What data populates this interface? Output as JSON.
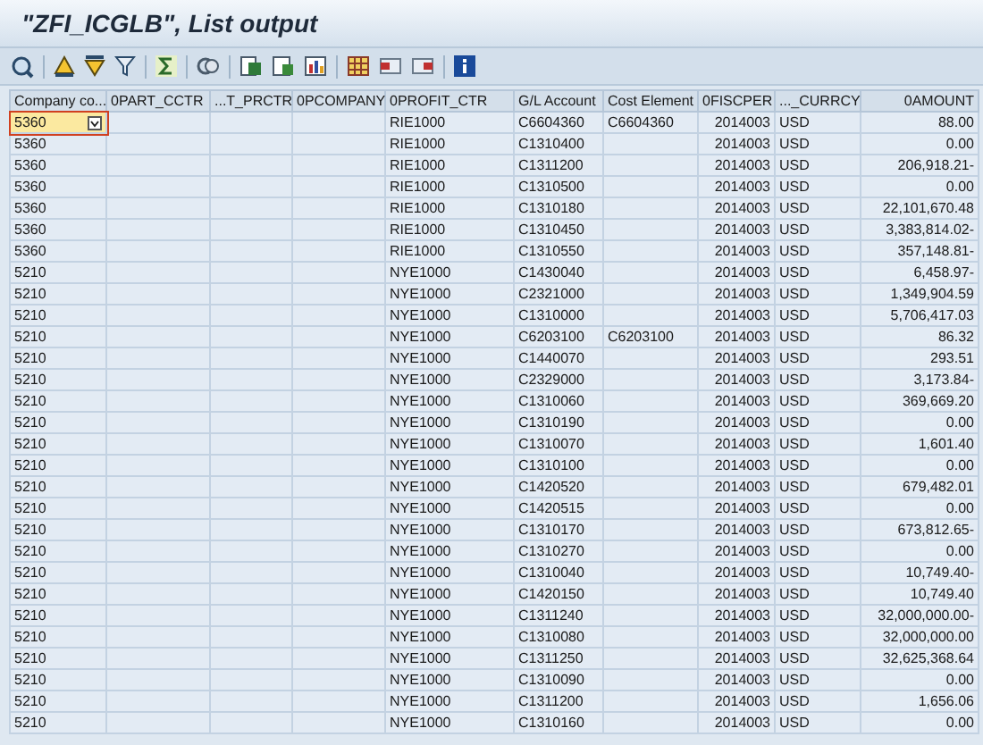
{
  "window": {
    "title": "\"ZFI_ICGLB\", List output"
  },
  "table": {
    "columns": [
      {
        "label": "Company co..."
      },
      {
        "label": "0PART_CCTR"
      },
      {
        "label": "...T_PRCTR"
      },
      {
        "label": "0PCOMPANY"
      },
      {
        "label": "0PROFIT_CTR"
      },
      {
        "label": "G/L Account"
      },
      {
        "label": "Cost Element"
      },
      {
        "label": "0FISCPER"
      },
      {
        "label": "..._CURRCY"
      },
      {
        "label": "0AMOUNT"
      }
    ],
    "rows": [
      {
        "selected": true,
        "company_code": "5360",
        "profit_ctr": "RIE1000",
        "gl_account": "C6604360",
        "cost_element": "C6604360",
        "fiscper": "2014003",
        "currency": "USD",
        "amount": "88.00"
      },
      {
        "selected": false,
        "company_code": "5360",
        "profit_ctr": "RIE1000",
        "gl_account": "C1310400",
        "fiscper": "2014003",
        "currency": "USD",
        "amount": "0.00"
      },
      {
        "selected": false,
        "company_code": "5360",
        "profit_ctr": "RIE1000",
        "gl_account": "C1311200",
        "fiscper": "2014003",
        "currency": "USD",
        "amount": "206,918.21-"
      },
      {
        "selected": false,
        "company_code": "5360",
        "profit_ctr": "RIE1000",
        "gl_account": "C1310500",
        "fiscper": "2014003",
        "currency": "USD",
        "amount": "0.00"
      },
      {
        "selected": false,
        "company_code": "5360",
        "profit_ctr": "RIE1000",
        "gl_account": "C1310180",
        "fiscper": "2014003",
        "currency": "USD",
        "amount": "22,101,670.48"
      },
      {
        "selected": false,
        "company_code": "5360",
        "profit_ctr": "RIE1000",
        "gl_account": "C1310450",
        "fiscper": "2014003",
        "currency": "USD",
        "amount": "3,383,814.02-"
      },
      {
        "selected": false,
        "company_code": "5360",
        "profit_ctr": "RIE1000",
        "gl_account": "C1310550",
        "fiscper": "2014003",
        "currency": "USD",
        "amount": "357,148.81-"
      },
      {
        "selected": false,
        "company_code": "5210",
        "profit_ctr": "NYE1000",
        "gl_account": "C1430040",
        "fiscper": "2014003",
        "currency": "USD",
        "amount": "6,458.97-"
      },
      {
        "selected": false,
        "company_code": "5210",
        "profit_ctr": "NYE1000",
        "gl_account": "C2321000",
        "fiscper": "2014003",
        "currency": "USD",
        "amount": "1,349,904.59"
      },
      {
        "selected": false,
        "company_code": "5210",
        "profit_ctr": "NYE1000",
        "gl_account": "C1310000",
        "fiscper": "2014003",
        "currency": "USD",
        "amount": "5,706,417.03"
      },
      {
        "selected": false,
        "company_code": "5210",
        "profit_ctr": "NYE1000",
        "gl_account": "C6203100",
        "cost_element": "C6203100",
        "fiscper": "2014003",
        "currency": "USD",
        "amount": "86.32"
      },
      {
        "selected": false,
        "company_code": "5210",
        "profit_ctr": "NYE1000",
        "gl_account": "C1440070",
        "fiscper": "2014003",
        "currency": "USD",
        "amount": "293.51"
      },
      {
        "selected": false,
        "company_code": "5210",
        "profit_ctr": "NYE1000",
        "gl_account": "C2329000",
        "fiscper": "2014003",
        "currency": "USD",
        "amount": "3,173.84-"
      },
      {
        "selected": false,
        "company_code": "5210",
        "profit_ctr": "NYE1000",
        "gl_account": "C1310060",
        "fiscper": "2014003",
        "currency": "USD",
        "amount": "369,669.20"
      },
      {
        "selected": false,
        "company_code": "5210",
        "profit_ctr": "NYE1000",
        "gl_account": "C1310190",
        "fiscper": "2014003",
        "currency": "USD",
        "amount": "0.00"
      },
      {
        "selected": false,
        "company_code": "5210",
        "profit_ctr": "NYE1000",
        "gl_account": "C1310070",
        "fiscper": "2014003",
        "currency": "USD",
        "amount": "1,601.40"
      },
      {
        "selected": false,
        "company_code": "5210",
        "profit_ctr": "NYE1000",
        "gl_account": "C1310100",
        "fiscper": "2014003",
        "currency": "USD",
        "amount": "0.00"
      },
      {
        "selected": false,
        "company_code": "5210",
        "profit_ctr": "NYE1000",
        "gl_account": "C1420520",
        "fiscper": "2014003",
        "currency": "USD",
        "amount": "679,482.01"
      },
      {
        "selected": false,
        "company_code": "5210",
        "profit_ctr": "NYE1000",
        "gl_account": "C1420515",
        "fiscper": "2014003",
        "currency": "USD",
        "amount": "0.00"
      },
      {
        "selected": false,
        "company_code": "5210",
        "profit_ctr": "NYE1000",
        "gl_account": "C1310170",
        "fiscper": "2014003",
        "currency": "USD",
        "amount": "673,812.65-"
      },
      {
        "selected": false,
        "company_code": "5210",
        "profit_ctr": "NYE1000",
        "gl_account": "C1310270",
        "fiscper": "2014003",
        "currency": "USD",
        "amount": "0.00"
      },
      {
        "selected": false,
        "company_code": "5210",
        "profit_ctr": "NYE1000",
        "gl_account": "C1310040",
        "fiscper": "2014003",
        "currency": "USD",
        "amount": "10,749.40-"
      },
      {
        "selected": false,
        "company_code": "5210",
        "profit_ctr": "NYE1000",
        "gl_account": "C1420150",
        "fiscper": "2014003",
        "currency": "USD",
        "amount": "10,749.40"
      },
      {
        "selected": false,
        "company_code": "5210",
        "profit_ctr": "NYE1000",
        "gl_account": "C1311240",
        "fiscper": "2014003",
        "currency": "USD",
        "amount": "32,000,000.00-"
      },
      {
        "selected": false,
        "company_code": "5210",
        "profit_ctr": "NYE1000",
        "gl_account": "C1310080",
        "fiscper": "2014003",
        "currency": "USD",
        "amount": "32,000,000.00"
      },
      {
        "selected": false,
        "company_code": "5210",
        "profit_ctr": "NYE1000",
        "gl_account": "C1311250",
        "fiscper": "2014003",
        "currency": "USD",
        "amount": "32,625,368.64"
      },
      {
        "selected": false,
        "company_code": "5210",
        "profit_ctr": "NYE1000",
        "gl_account": "C1310090",
        "fiscper": "2014003",
        "currency": "USD",
        "amount": "0.00"
      },
      {
        "selected": false,
        "company_code": "5210",
        "profit_ctr": "NYE1000",
        "gl_account": "C1311200",
        "fiscper": "2014003",
        "currency": "USD",
        "amount": "1,656.06"
      },
      {
        "selected": false,
        "company_code": "5210",
        "profit_ctr": "NYE1000",
        "gl_account": "C1310160",
        "fiscper": "2014003",
        "currency": "USD",
        "amount": "0.00"
      }
    ]
  }
}
